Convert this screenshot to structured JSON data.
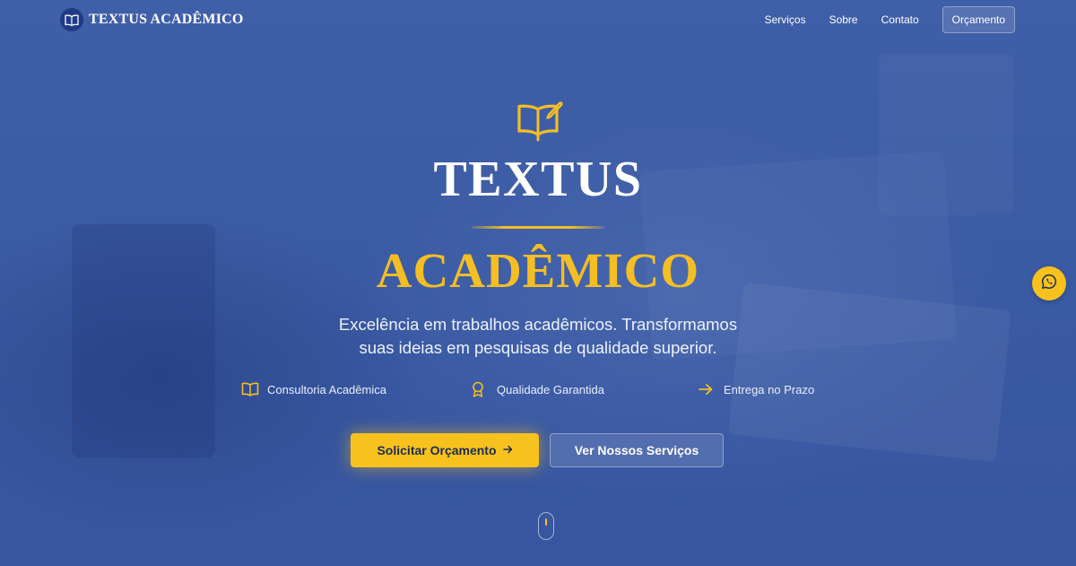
{
  "nav": {
    "brand": "TEXTUS ACADÊMICO",
    "links": [
      "Serviços",
      "Sobre",
      "Contato"
    ],
    "cta": "Orçamento"
  },
  "hero": {
    "title_top": "TEXTUS",
    "title_bottom": "ACADÊMICO",
    "subtitle_line1": "Excelência em trabalhos acadêmicos. Transformamos",
    "subtitle_line2": "suas ideias em pesquisas de qualidade superior.",
    "features": [
      {
        "label": "Consultoria Acadêmica",
        "icon": "book-open-icon"
      },
      {
        "label": "Qualidade Garantida",
        "icon": "award-icon"
      },
      {
        "label": "Entrega no Prazo",
        "icon": "arrow-right-icon"
      }
    ],
    "primary_button": "Solicitar Orçamento",
    "primary_button_icon": "arrow-right-icon",
    "secondary_button": "Ver Nossos Serviços",
    "hero_icon": "book-open-pen-icon"
  },
  "floating": {
    "whatsapp_icon": "whatsapp-icon"
  },
  "colors": {
    "background": "#3b5aa1",
    "accent": "#f7c21d",
    "brand_badge": "#1f3a86",
    "text_light": "#ffffff"
  }
}
